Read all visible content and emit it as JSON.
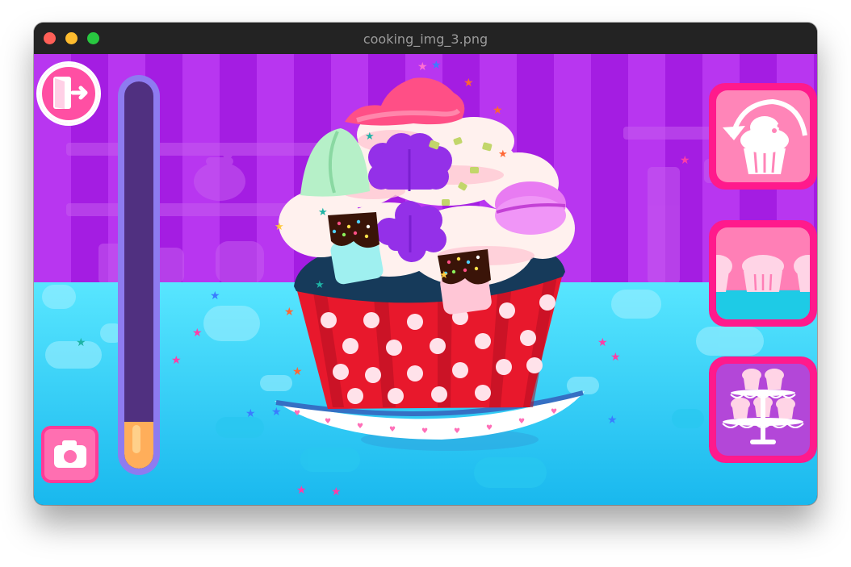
{
  "window": {
    "title": "cooking_img_3.png"
  },
  "hud": {
    "exit_icon": "exit-door-icon",
    "camera_icon": "camera-icon",
    "reset_icon": "reset-cupcake-icon",
    "tray_icon": "cupcake-tray-icon",
    "stand_icon": "cupcake-stand-icon",
    "fill_level": 0.12
  },
  "colors": {
    "wall": "#a21be0",
    "wall_stripe": "#c34cf4",
    "floor": "#3ed2f2",
    "button_pink": "#ff1a8c",
    "wrapper_red": "#e8182c",
    "frosting": "#fff1ee",
    "frosting_top": "#ff5a8f"
  }
}
